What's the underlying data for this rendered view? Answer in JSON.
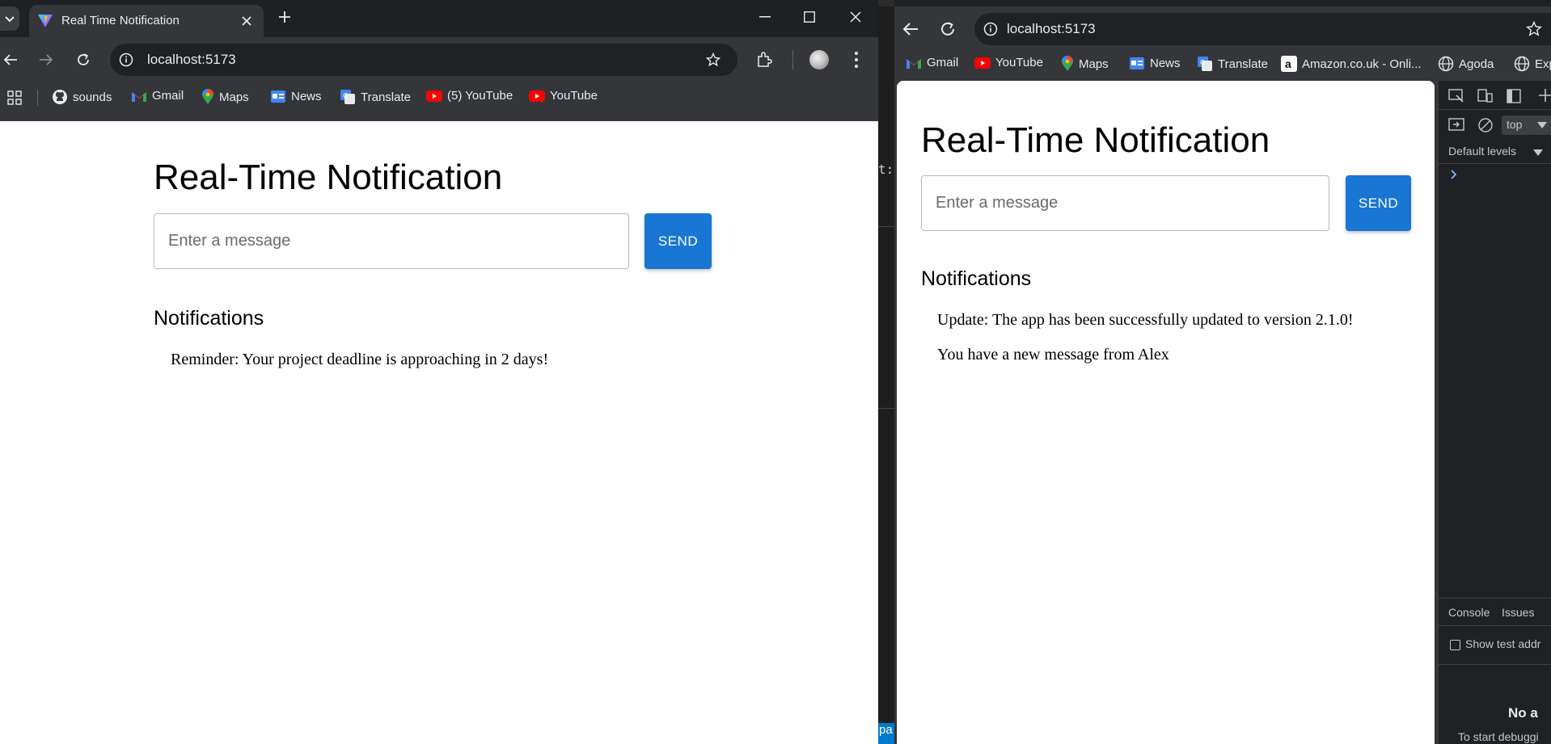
{
  "left_window": {
    "tab_title": "Real Time Notification",
    "url": "localhost:5173",
    "bookmarks": [
      {
        "label": "sounds",
        "icon": "github-icon"
      },
      {
        "label": "Gmail",
        "icon": "gmail-icon"
      },
      {
        "label": "Maps",
        "icon": "maps-icon"
      },
      {
        "label": "News",
        "icon": "news-icon"
      },
      {
        "label": "Translate",
        "icon": "translate-icon"
      },
      {
        "label": "(5) YouTube",
        "icon": "youtube-icon"
      },
      {
        "label": "YouTube",
        "icon": "youtube-icon"
      }
    ],
    "page": {
      "title": "Real-Time Notification",
      "input_placeholder": "Enter a message",
      "send_label": "SEND",
      "notifications_heading": "Notifications",
      "notifications": [
        "Reminder: Your project deadline is approaching in 2 days!"
      ]
    }
  },
  "right_window": {
    "url": "localhost:5173",
    "bookmarks": [
      {
        "label": "Gmail",
        "icon": "gmail-icon"
      },
      {
        "label": "YouTube",
        "icon": "youtube-icon"
      },
      {
        "label": "Maps",
        "icon": "maps-icon"
      },
      {
        "label": "News",
        "icon": "news-icon"
      },
      {
        "label": "Translate",
        "icon": "translate-icon"
      },
      {
        "label": "Amazon.co.uk - Onli...",
        "icon": "amazon-icon"
      },
      {
        "label": "Agoda",
        "icon": "globe-icon"
      },
      {
        "label": "Exp",
        "icon": "globe-icon"
      }
    ],
    "page": {
      "title": "Real-Time Notification",
      "input_placeholder": "Enter a message",
      "send_label": "SEND",
      "notifications_heading": "Notifications",
      "notifications": [
        "Update: The app has been successfully updated to version 2.1.0!",
        "You have a new message from Alex"
      ]
    },
    "devtools": {
      "context": "top",
      "levels": "Default levels",
      "drawer_tabs": [
        "Console",
        "Issues"
      ],
      "show_test_label": "Show test addr",
      "no_text": "No a",
      "debug_hint": "To start debuggi"
    }
  },
  "gap_text": {
    "top": "t:",
    "bottom": "pa"
  },
  "colors": {
    "send_button": "#1976d2",
    "chrome_dark": "#35363a",
    "tabstrip": "#1f2023"
  }
}
